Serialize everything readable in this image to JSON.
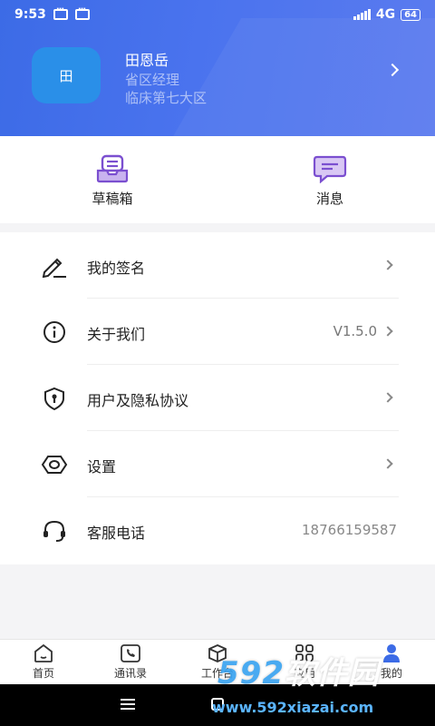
{
  "status_bar": {
    "time": "9:53",
    "network": "4G",
    "battery": "64"
  },
  "profile": {
    "avatar_text": "田",
    "name": "田恩岳",
    "title": "省区经理",
    "region": "临床第七大区"
  },
  "quick_actions": [
    {
      "label": "草稿箱",
      "icon": "draft-box-icon"
    },
    {
      "label": "消息",
      "icon": "message-icon"
    }
  ],
  "menu": [
    {
      "label": "我的签名",
      "icon": "signature-pen-icon",
      "value": ""
    },
    {
      "label": "关于我们",
      "icon": "info-icon",
      "value": "V1.5.0"
    },
    {
      "label": "用户及隐私协议",
      "icon": "shield-lock-icon",
      "value": ""
    },
    {
      "label": "设置",
      "icon": "settings-hex-icon",
      "value": ""
    },
    {
      "label": "客服电话",
      "icon": "headset-icon",
      "value": "18766159587"
    }
  ],
  "bottom_nav": [
    {
      "label": "首页",
      "icon": "home-icon"
    },
    {
      "label": "通讯录",
      "icon": "contacts-phone-icon"
    },
    {
      "label": "工作台",
      "icon": "workbench-box-icon"
    },
    {
      "label": "应用",
      "icon": "apps-grid-icon"
    },
    {
      "label": "我的",
      "icon": "profile-user-icon"
    }
  ],
  "watermark": {
    "brand_number": "592",
    "brand_text": "软件园",
    "url": "www.592xiazai.com"
  },
  "colors": {
    "header_gradient_start": "#3c6be6",
    "header_gradient_end": "#5b7bef",
    "accent_purple": "#7b4fd0",
    "avatar_bg": "#2a8fe8"
  }
}
